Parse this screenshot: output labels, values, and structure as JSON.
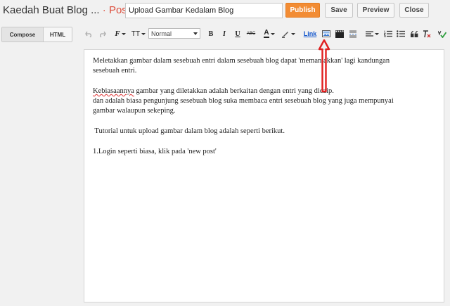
{
  "header": {
    "blog_title": "Kaedah Buat Blog ...",
    "separator": "·",
    "section": "Post",
    "post_title_value": "Upload Gambar Kedalam Blog",
    "publish_label": "Publish",
    "save_label": "Save",
    "preview_label": "Preview",
    "close_label": "Close"
  },
  "toolbar": {
    "compose_label": "Compose",
    "html_label": "HTML",
    "font_style": "Normal",
    "bold": "B",
    "italic": "I",
    "underline": "U",
    "strike": "ABC",
    "text_color": "A",
    "link_label": "Link",
    "font_icon": "F",
    "size_icon": "TT"
  },
  "content": {
    "p1_line1": "Meletakkan gambar dalam sesebuah entri dalam sesebuah blog dapat 'memantakkan' lagi kandungan",
    "p1_line2": "sesebuah entri.",
    "p2_word": "Kebiasaannya",
    "p2_rest": " gambar yang diletakkan adalah berkaitan dengan entri yang dicaip.",
    "p3_line1": "dan adalah biasa pengunjung sesebuah blog suka membaca entri sesebuah blog yang juga mempunyai",
    "p3_line2": "gambar walaupun sekeping.",
    "p4": " Tutorial untuk upload gambar dalam blog adalah seperti berikut.",
    "p5": "1.Login seperti biasa, klik pada 'new post'"
  },
  "colors": {
    "publish": "#f28c34",
    "title_accent": "#dd4b39",
    "link": "#1155cc",
    "arrow": "#e02020"
  }
}
